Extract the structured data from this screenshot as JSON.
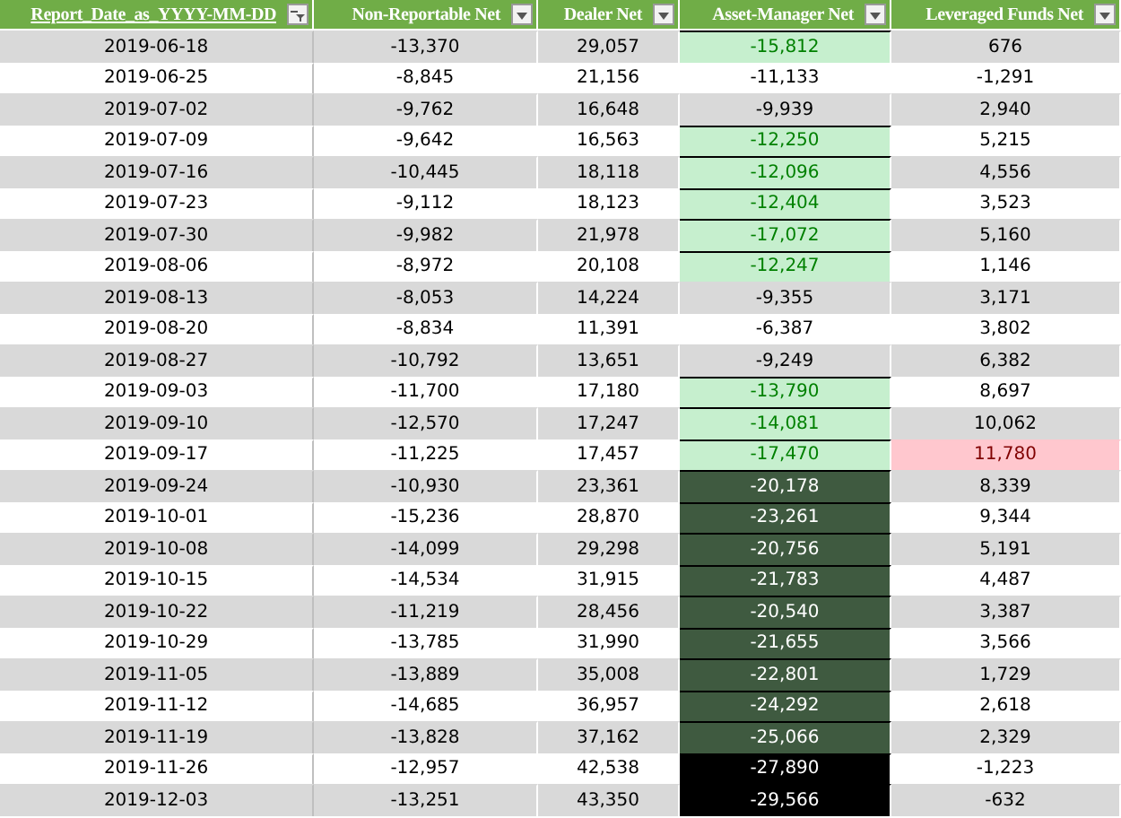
{
  "columns": [
    {
      "label": "Report_Date_as_YYYY-MM-DD",
      "filtered": true
    },
    {
      "label": "Non-Reportable Net",
      "filtered": false
    },
    {
      "label": "Dealer Net",
      "filtered": false
    },
    {
      "label": "Asset-Manager Net",
      "filtered": false
    },
    {
      "label": "Leveraged Funds Net",
      "filtered": false
    }
  ],
  "rows": [
    {
      "date": "2019-06-18",
      "non_reportable": "-13,370",
      "dealer": "29,057",
      "asset_manager": {
        "value": "-15,812",
        "color": "#c6efce"
      },
      "leveraged": {
        "value": "676"
      }
    },
    {
      "date": "2019-06-25",
      "non_reportable": "-8,845",
      "dealer": "21,156",
      "asset_manager": {
        "value": "-11,133"
      },
      "leveraged": {
        "value": "-1,291"
      }
    },
    {
      "date": "2019-07-02",
      "non_reportable": "-9,762",
      "dealer": "16,648",
      "asset_manager": {
        "value": "-9,939"
      },
      "leveraged": {
        "value": "2,940"
      }
    },
    {
      "date": "2019-07-09",
      "non_reportable": "-9,642",
      "dealer": "16,563",
      "asset_manager": {
        "value": "-12,250",
        "color": "#c6efce"
      },
      "leveraged": {
        "value": "5,215"
      }
    },
    {
      "date": "2019-07-16",
      "non_reportable": "-10,445",
      "dealer": "18,118",
      "asset_manager": {
        "value": "-12,096",
        "color": "#c6efce"
      },
      "leveraged": {
        "value": "4,556"
      }
    },
    {
      "date": "2019-07-23",
      "non_reportable": "-9,112",
      "dealer": "18,123",
      "asset_manager": {
        "value": "-12,404",
        "color": "#c6efce"
      },
      "leveraged": {
        "value": "3,523"
      }
    },
    {
      "date": "2019-07-30",
      "non_reportable": "-9,982",
      "dealer": "21,978",
      "asset_manager": {
        "value": "-17,072",
        "color": "#c6efce"
      },
      "leveraged": {
        "value": "5,160"
      }
    },
    {
      "date": "2019-08-06",
      "non_reportable": "-8,972",
      "dealer": "20,108",
      "asset_manager": {
        "value": "-12,247",
        "color": "#c6efce"
      },
      "leveraged": {
        "value": "1,146"
      }
    },
    {
      "date": "2019-08-13",
      "non_reportable": "-8,053",
      "dealer": "14,224",
      "asset_manager": {
        "value": "-9,355"
      },
      "leveraged": {
        "value": "3,171"
      }
    },
    {
      "date": "2019-08-20",
      "non_reportable": "-8,834",
      "dealer": "11,391",
      "asset_manager": {
        "value": "-6,387"
      },
      "leveraged": {
        "value": "3,802"
      }
    },
    {
      "date": "2019-08-27",
      "non_reportable": "-10,792",
      "dealer": "13,651",
      "asset_manager": {
        "value": "-9,249"
      },
      "leveraged": {
        "value": "6,382"
      }
    },
    {
      "date": "2019-09-03",
      "non_reportable": "-11,700",
      "dealer": "17,180",
      "asset_manager": {
        "value": "-13,790",
        "color": "#c6efce"
      },
      "leveraged": {
        "value": "8,697"
      }
    },
    {
      "date": "2019-09-10",
      "non_reportable": "-12,570",
      "dealer": "17,247",
      "asset_manager": {
        "value": "-14,081",
        "color": "#c6efce"
      },
      "leveraged": {
        "value": "10,062"
      }
    },
    {
      "date": "2019-09-17",
      "non_reportable": "-11,225",
      "dealer": "17,457",
      "asset_manager": {
        "value": "-17,470",
        "color": "#c6efce"
      },
      "leveraged": {
        "value": "11,780",
        "color": "#ffc7ce"
      }
    },
    {
      "date": "2019-09-24",
      "non_reportable": "-10,930",
      "dealer": "23,361",
      "asset_manager": {
        "value": "-20,178",
        "color": "#3f5a40"
      },
      "leveraged": {
        "value": "8,339"
      }
    },
    {
      "date": "2019-10-01",
      "non_reportable": "-15,236",
      "dealer": "28,870",
      "asset_manager": {
        "value": "-23,261",
        "color": "#3f5a40"
      },
      "leveraged": {
        "value": "9,344"
      }
    },
    {
      "date": "2019-10-08",
      "non_reportable": "-14,099",
      "dealer": "29,298",
      "asset_manager": {
        "value": "-20,756",
        "color": "#3f5a40"
      },
      "leveraged": {
        "value": "5,191"
      }
    },
    {
      "date": "2019-10-15",
      "non_reportable": "-14,534",
      "dealer": "31,915",
      "asset_manager": {
        "value": "-21,783",
        "color": "#3f5a40"
      },
      "leveraged": {
        "value": "4,487"
      }
    },
    {
      "date": "2019-10-22",
      "non_reportable": "-11,219",
      "dealer": "28,456",
      "asset_manager": {
        "value": "-20,540",
        "color": "#3f5a40"
      },
      "leveraged": {
        "value": "3,387"
      }
    },
    {
      "date": "2019-10-29",
      "non_reportable": "-13,785",
      "dealer": "31,990",
      "asset_manager": {
        "value": "-21,655",
        "color": "#3f5a40"
      },
      "leveraged": {
        "value": "3,566"
      }
    },
    {
      "date": "2019-11-05",
      "non_reportable": "-13,889",
      "dealer": "35,008",
      "asset_manager": {
        "value": "-22,801",
        "color": "#3f5a40"
      },
      "leveraged": {
        "value": "1,729"
      }
    },
    {
      "date": "2019-11-12",
      "non_reportable": "-14,685",
      "dealer": "36,957",
      "asset_manager": {
        "value": "-24,292",
        "color": "#3f5a40"
      },
      "leveraged": {
        "value": "2,618"
      }
    },
    {
      "date": "2019-11-19",
      "non_reportable": "-13,828",
      "dealer": "37,162",
      "asset_manager": {
        "value": "-25,066",
        "color": "#3f5a40"
      },
      "leveraged": {
        "value": "2,329"
      }
    },
    {
      "date": "2019-11-26",
      "non_reportable": "-12,957",
      "dealer": "42,538",
      "asset_manager": {
        "value": "-27,890",
        "color": "#000000"
      },
      "leveraged": {
        "value": "-1,223"
      }
    },
    {
      "date": "2019-12-03",
      "non_reportable": "-13,251",
      "dealer": "43,350",
      "asset_manager": {
        "value": "-29,566",
        "color": "#000000"
      },
      "leveraged": {
        "value": "-632"
      }
    }
  ]
}
